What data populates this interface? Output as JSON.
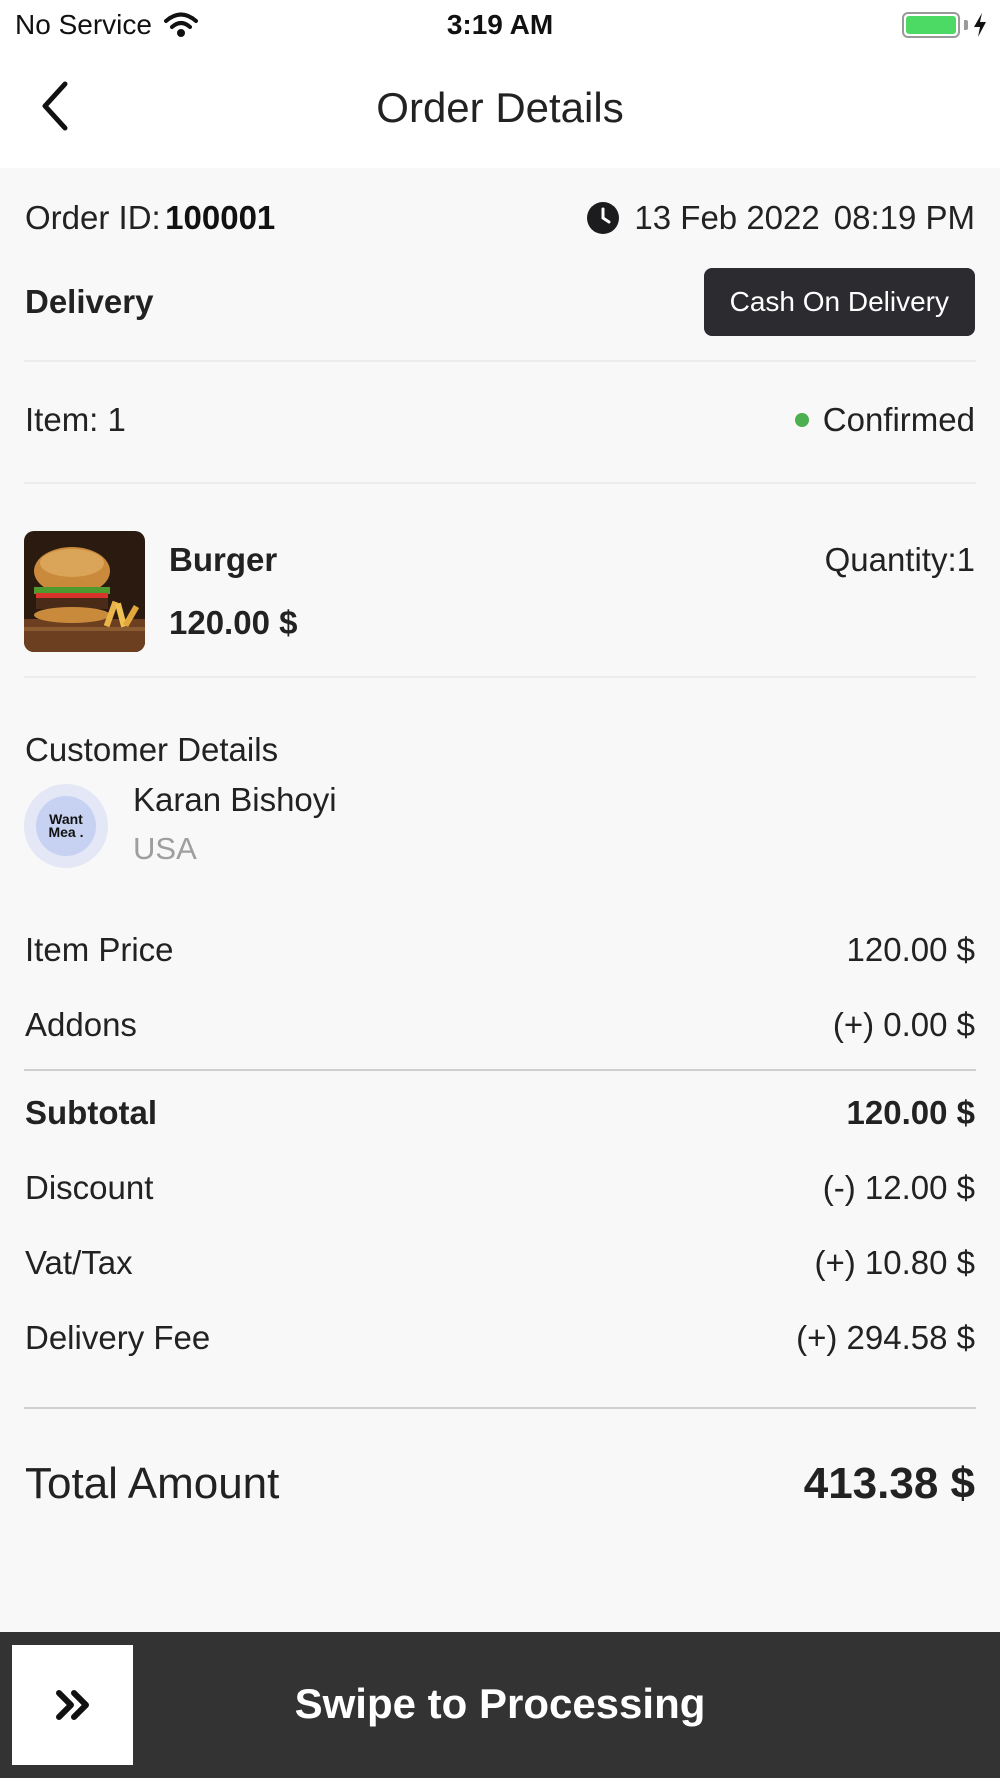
{
  "status_bar": {
    "carrier": "No Service",
    "time": "3:19 AM",
    "battery_color": "#4cd964"
  },
  "header": {
    "title": "Order Details"
  },
  "order": {
    "id_label": "Order ID:",
    "id_value": "100001",
    "date": "13 Feb 2022",
    "time": "08:19 PM",
    "type": "Delivery",
    "payment_method": "Cash On Delivery",
    "item_count": "Item: 1",
    "status": "Confirmed",
    "status_color": "#4caf50"
  },
  "item": {
    "name": "Burger",
    "price": "120.00 $",
    "quantity": "Quantity:1",
    "image": "burger-photo"
  },
  "customer": {
    "heading": "Customer Details",
    "name": "Karan Bishoyi",
    "country": "USA",
    "avatar_text_line1": "Want",
    "avatar_text_line2": "Mea ."
  },
  "summary": {
    "item_price_label": "Item Price",
    "item_price_value": "120.00 $",
    "addons_label": "Addons",
    "addons_value": "(+) 0.00 $",
    "subtotal_label": "Subtotal",
    "subtotal_value": "120.00 $",
    "discount_label": "Discount",
    "discount_value": "(-) 12.00 $",
    "tax_label": "Vat/Tax",
    "tax_value": "(+) 10.80 $",
    "delivery_fee_label": "Delivery Fee",
    "delivery_fee_value": "(+) 294.58 $",
    "total_label": "Total Amount",
    "total_value": "413.38 $"
  },
  "swipe": {
    "label": "Swipe to Processing",
    "handle_icon": "double-chevron-right-icon"
  }
}
